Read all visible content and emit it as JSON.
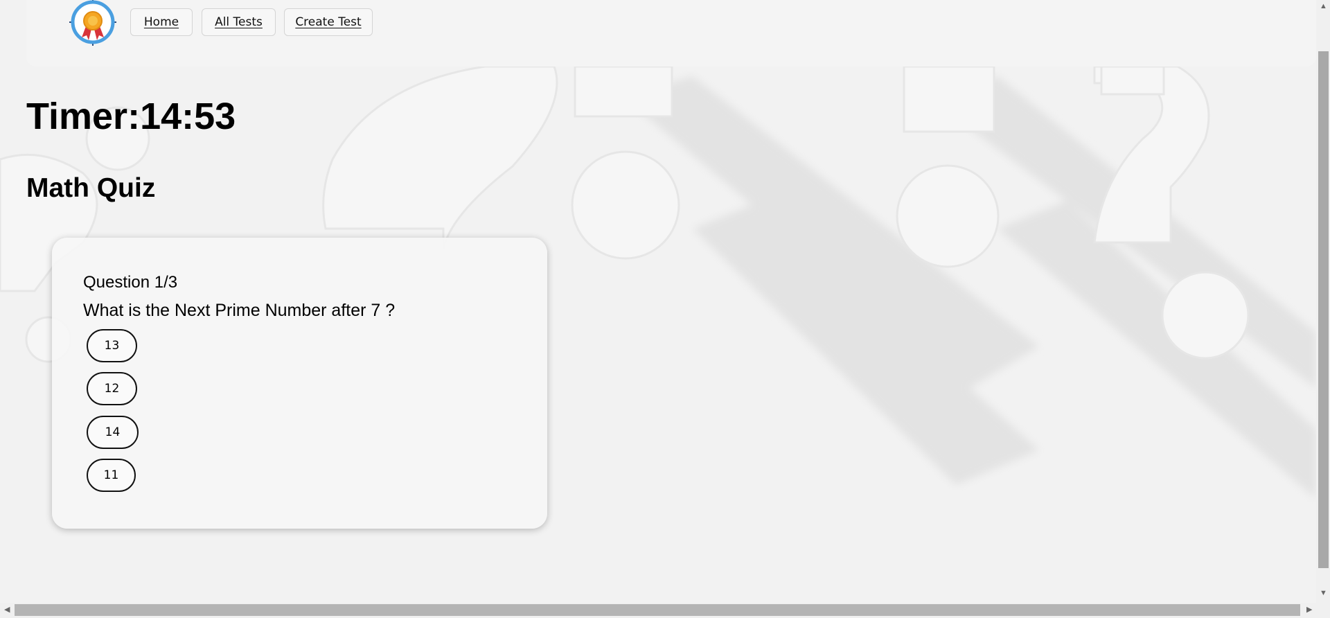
{
  "nav": {
    "logo": "award-badge-logo",
    "items": [
      {
        "label": "Home"
      },
      {
        "label": "All Tests"
      },
      {
        "label": "Create Test"
      }
    ]
  },
  "timer": {
    "label": "Timer:",
    "value": "14:53"
  },
  "quiz": {
    "title": "Math Quiz",
    "counter": "Question 1/3",
    "question": "What is the Next Prime Number after 7 ?",
    "options": [
      "13",
      "12",
      "14",
      "11"
    ]
  },
  "colors": {
    "background": "#f2f2f2",
    "logo_ring": "#4a9fe0",
    "medal_gold": "#f5a623",
    "ribbon_red": "#d8343a"
  },
  "icons": {
    "scroll_up": "chevron-up-icon",
    "scroll_down": "chevron-down-icon",
    "scroll_left": "chevron-left-icon",
    "scroll_right": "chevron-right-icon"
  }
}
